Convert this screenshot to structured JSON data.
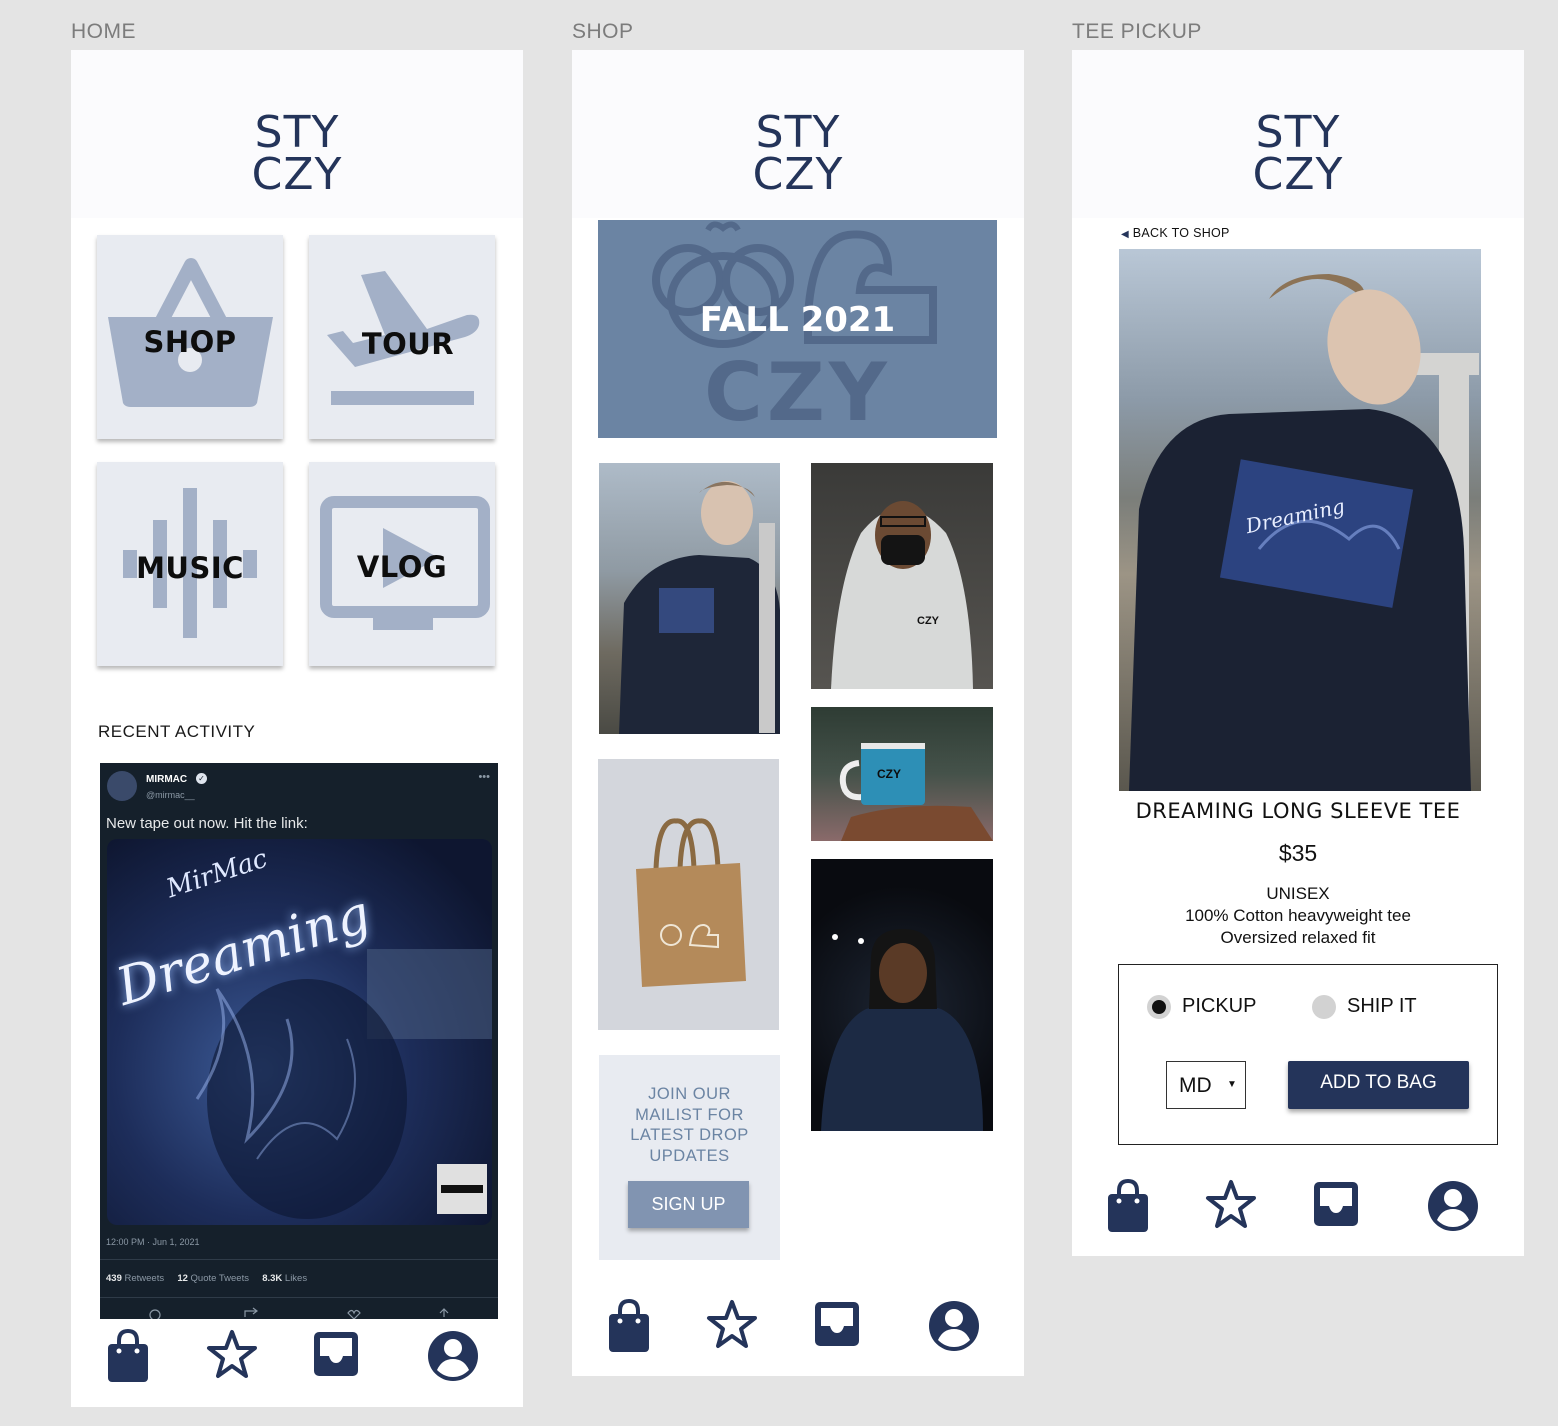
{
  "brand": {
    "line1": "STY",
    "line2": "CZY"
  },
  "colors": {
    "navy": "#24345a",
    "slate": "#6b84a3",
    "tile_bg": "#e8ebf1",
    "icon_fill": "#a3b0c7"
  },
  "frames": {
    "home": {
      "label": "HOME"
    },
    "shop": {
      "label": "SHOP"
    },
    "tee": {
      "label": "TEE PICKUP"
    }
  },
  "home": {
    "tiles": [
      {
        "label": "SHOP",
        "icon": "shopping-basket-icon"
      },
      {
        "label": "TOUR",
        "icon": "airplane-landing-icon"
      },
      {
        "label": "MUSIC",
        "icon": "sound-wave-icon"
      },
      {
        "label": "VLOG",
        "icon": "tv-play-icon"
      }
    ],
    "recent_title": "RECENT ACTIVITY",
    "tweet": {
      "name": "MIRMAC",
      "handle": "@mirmac__",
      "text": "New tape out now. Hit the link:",
      "image_title_1": "MirMac",
      "image_title_2": "Dreaming",
      "time": "12:00 PM · Jun 1, 2021",
      "retweets_count": "439",
      "retweets_label": "Retweets",
      "quotes_count": "12",
      "quotes_label": "Quote Tweets",
      "likes_count": "8.3K",
      "likes_label": "Likes"
    }
  },
  "shop": {
    "banner_text": "FALL 2021",
    "banner_watermark": "CZY",
    "mug_label": "CZY",
    "hoodie_label": "CZY",
    "mailist": {
      "line1": "JOIN OUR",
      "line2": "MAILIST FOR",
      "line3": "LATEST DROP",
      "line4": "UPDATES",
      "button": "SIGN UP"
    }
  },
  "tee": {
    "back_link": "BACK TO SHOP",
    "product_name": "DREAMING LONG SLEEVE TEE",
    "price": "$35",
    "desc_line1": "UNISEX",
    "desc_line2": "100% Cotton heavyweight tee",
    "desc_line3": "Oversized relaxed fit",
    "option_pickup": "PICKUP",
    "option_ship": "SHIP IT",
    "selected_option": "PICKUP",
    "size_selected": "MD",
    "add_button": "ADD TO BAG",
    "shirt_print": "Dreaming"
  },
  "nav": [
    "shopping-bag-icon",
    "star-icon",
    "inbox-icon",
    "account-icon"
  ]
}
